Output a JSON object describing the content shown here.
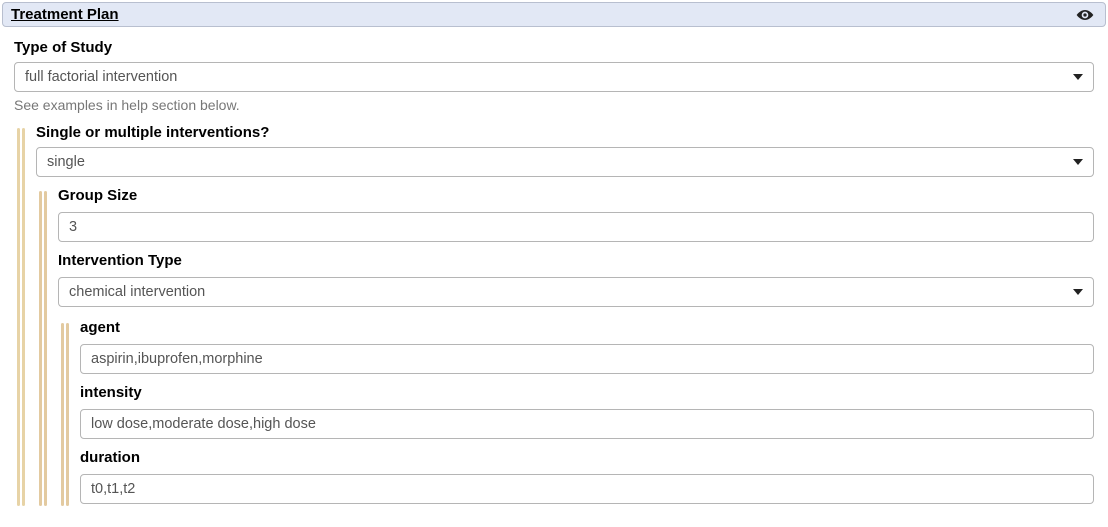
{
  "panel": {
    "title": "Treatment Plan"
  },
  "study": {
    "label": "Type of Study",
    "value": "full factorial intervention",
    "helper": "See examples in help section below."
  },
  "interventions": {
    "mode_label": "Single or multiple interventions?",
    "mode_value": "single",
    "group_size_label": "Group Size",
    "group_size_value": "3",
    "type_label": "Intervention Type",
    "type_value": "chemical intervention",
    "agent_label": "agent",
    "agent_value": "aspirin,ibuprofen,morphine",
    "intensity_label": "intensity",
    "intensity_value": "low dose,moderate dose,high dose",
    "duration_label": "duration",
    "duration_value": "t0,t1,t2"
  }
}
